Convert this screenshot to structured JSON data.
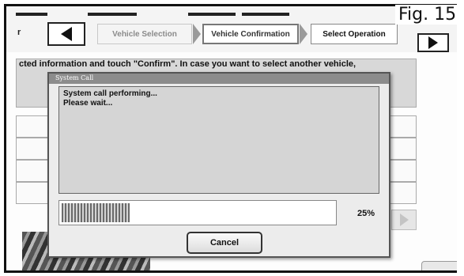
{
  "figure_label": "Fig. 15",
  "nav": {
    "left_crumb_fragment": "r",
    "steps": [
      {
        "label": "Vehicle Selection"
      },
      {
        "label": "Vehicle Confirmation"
      },
      {
        "label": "Select Operation"
      }
    ]
  },
  "instruction_text": "cted information and touch \"Confirm\". In case you want to select another vehicle,",
  "dialog": {
    "title": "System Call",
    "message_lines": [
      "System call performing...",
      "Please wait..."
    ],
    "progress_percent": 25,
    "progress_label": "25%",
    "cancel_label": "Cancel"
  },
  "colors": {
    "dialog_titlebar": "#8c8c8c",
    "message_bg": "#d5d5d5",
    "progress_fill": "#6a6a6a"
  }
}
